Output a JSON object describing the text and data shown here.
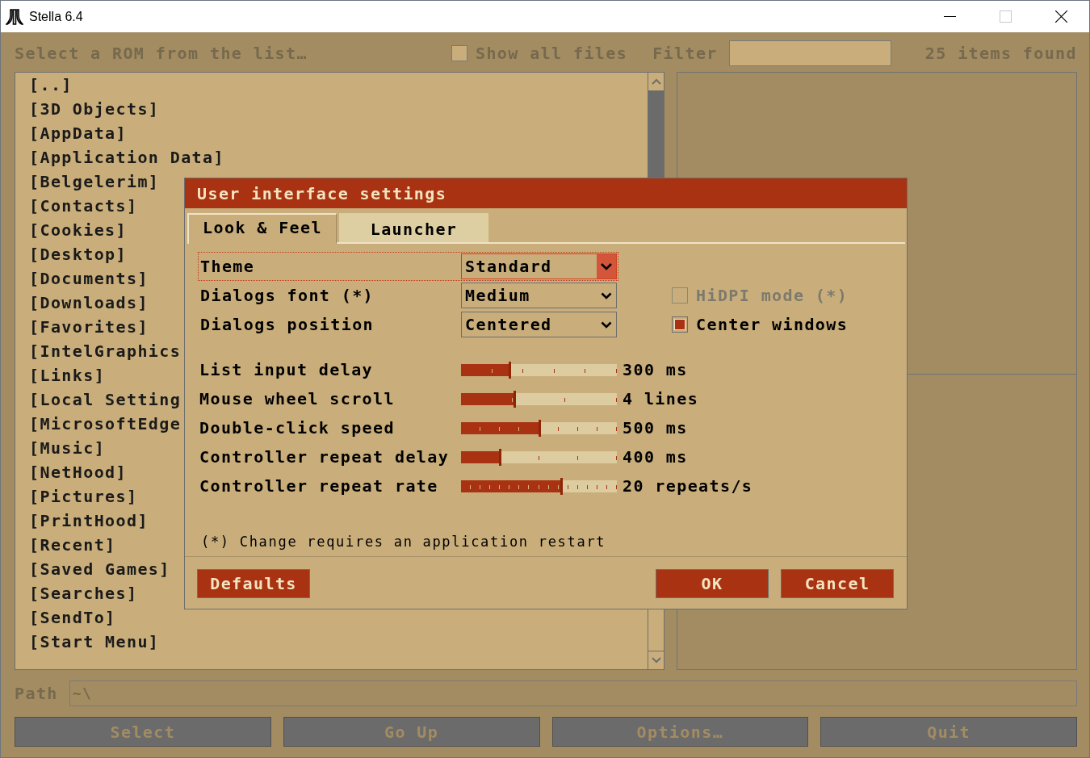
{
  "window": {
    "title": "Stella 6.4",
    "controls": [
      {
        "kind": "minimize",
        "disabled": false
      },
      {
        "kind": "maximize",
        "disabled": true
      },
      {
        "kind": "close",
        "disabled": false
      }
    ]
  },
  "launcher": {
    "dimmed": true,
    "header": {
      "prompt": "Select a ROM from the list…",
      "show_all_files": {
        "label": "Show all files",
        "checked": false
      },
      "filter": {
        "label": "Filter"
      },
      "item_count": "25 items found"
    },
    "file_list": {
      "items": [
        "[..]",
        "[3D Objects]",
        "[AppData]",
        "[Application Data]",
        "[Belgelerim]",
        "[Contacts]",
        "[Cookies]",
        "[Desktop]",
        "[Documents]",
        "[Downloads]",
        "[Favorites]",
        "[IntelGraphics",
        "[Links]",
        "[Local Setting",
        "[MicrosoftEdge",
        "[Music]",
        "[NetHood]",
        "[Pictures]",
        "[PrintHood]",
        "[Recent]",
        "[Saved Games]",
        "[Searches]",
        "[SendTo]",
        "[Start Menu]"
      ]
    },
    "path": {
      "label": "Path",
      "value": "~\\"
    },
    "buttons": [
      "Select",
      "Go Up",
      "Options…",
      "Quit"
    ]
  },
  "dialog": {
    "title": "User interface settings",
    "tabs": [
      {
        "label": "Look & Feel",
        "selected": true
      },
      {
        "label": "Launcher",
        "selected": false
      }
    ],
    "dropdowns": [
      {
        "label": "Theme",
        "value": "Standard",
        "focused": true
      },
      {
        "label": "Dialogs font (*)",
        "value": "Medium",
        "focused": false
      },
      {
        "label": "Dialogs position",
        "value": "Centered",
        "focused": false
      }
    ],
    "checkboxes": [
      {
        "label": "HiDPI mode (*)",
        "checked": false,
        "disabled": true
      },
      {
        "label": "Center windows",
        "checked": true,
        "disabled": false
      }
    ],
    "sliders": [
      {
        "label": "List input delay",
        "level": 0.31,
        "reading": "300 ms"
      },
      {
        "label": "Mouse wheel scroll",
        "level": 0.34,
        "reading": "4 lines"
      },
      {
        "label": "Double-click speed",
        "level": 0.5,
        "reading": "500 ms"
      },
      {
        "label": "Controller repeat delay",
        "level": 0.25,
        "reading": "400 ms"
      },
      {
        "label": "Controller repeat rate",
        "level": 0.64,
        "reading": "20 repeats/s"
      }
    ],
    "note": "(*) Change requires an application restart",
    "buttons": [
      "Defaults",
      "OK",
      "Cancel"
    ]
  }
}
